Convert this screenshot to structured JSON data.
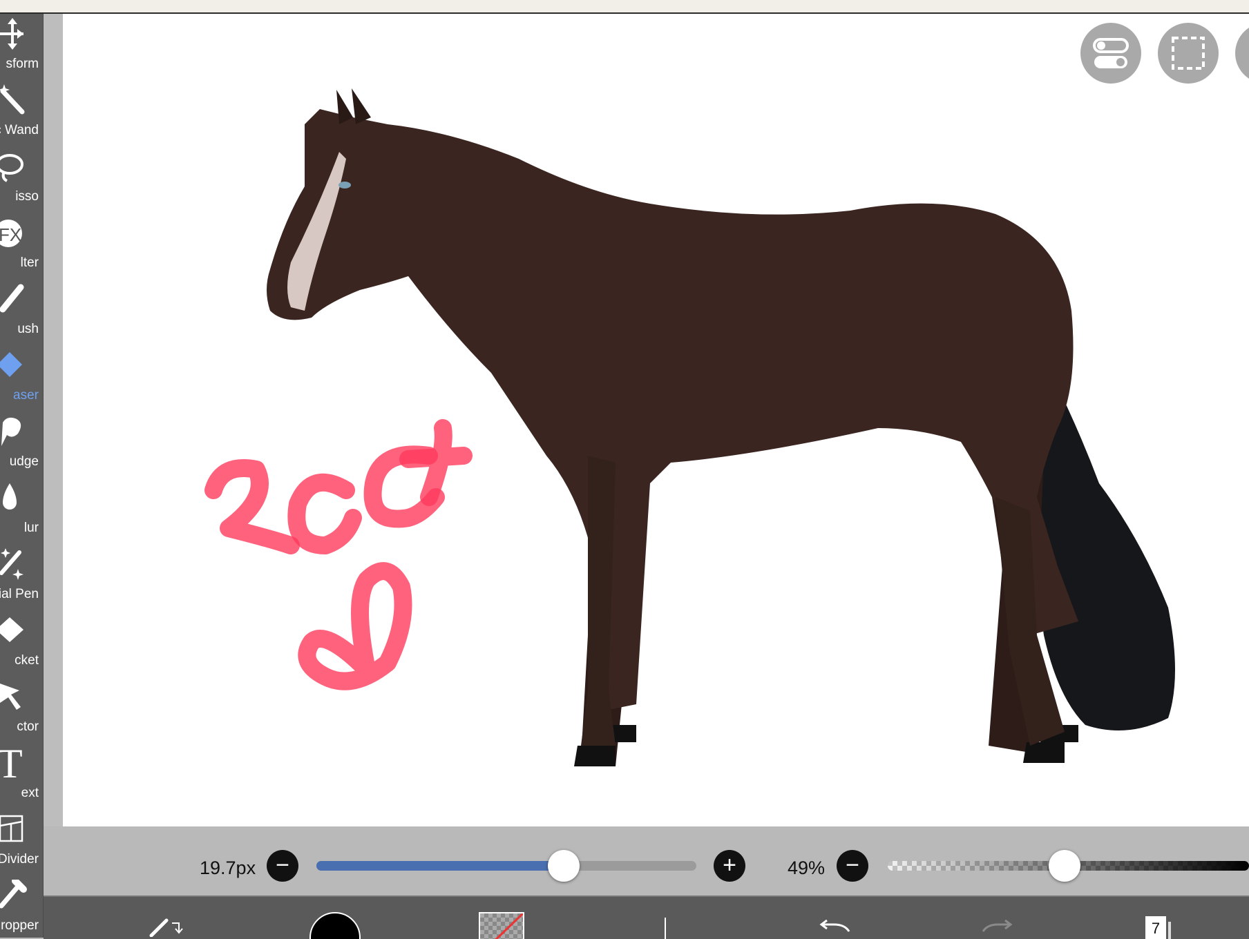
{
  "tools": [
    {
      "label": "sform",
      "icon": "transform-icon"
    },
    {
      "label": "c Wand",
      "icon": "magic-wand-icon"
    },
    {
      "label": "isso",
      "icon": "lasso-icon"
    },
    {
      "label": "lter",
      "icon": "filter-fx-icon",
      "glyph": "FX"
    },
    {
      "label": "ush",
      "icon": "brush-icon"
    },
    {
      "label": "aser",
      "icon": "eraser-icon",
      "active": true
    },
    {
      "label": "udge",
      "icon": "smudge-icon"
    },
    {
      "label": "lur",
      "icon": "blur-icon"
    },
    {
      "label": "ial Pen",
      "icon": "special-pen-icon"
    },
    {
      "label": "cket",
      "icon": "bucket-icon"
    },
    {
      "label": "ctor",
      "icon": "selector-icon"
    },
    {
      "label": "ext",
      "icon": "text-icon",
      "glyph": "T"
    },
    {
      "label": "Divider",
      "icon": "frame-divider-icon"
    },
    {
      "label": "ropper",
      "icon": "eyedropper-icon"
    }
  ],
  "brush": {
    "size_label": "19.7px",
    "size_fraction": 0.65,
    "opacity_label": "49%",
    "opacity_fraction": 0.49
  },
  "bottom": {
    "layer_count": "7"
  },
  "colors": {
    "accent": "#6fa0ef",
    "slider_fill": "#4a6fb0",
    "brush_color": "#000000",
    "horse_coat": "#3a2520",
    "tail": "#16171a",
    "doodle": "#ff3b5c"
  }
}
